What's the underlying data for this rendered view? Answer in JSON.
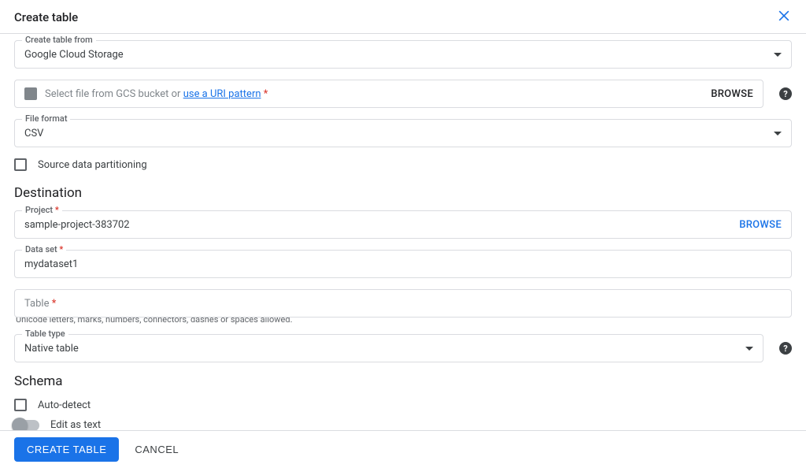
{
  "header": {
    "title": "Create table"
  },
  "source": {
    "create_from_label": "Create table from",
    "create_from_value": "Google Cloud Storage",
    "file_prompt_prefix": "Select file from GCS bucket or ",
    "file_prompt_link": "use a URI pattern",
    "browse_label": "BROWSE",
    "file_format_label": "File format",
    "file_format_value": "CSV",
    "partitioning_label": "Source data partitioning"
  },
  "destination": {
    "title": "Destination",
    "project_label": "Project",
    "project_value": "sample-project-383702",
    "browse_label": "BROWSE",
    "dataset_label": "Data set",
    "dataset_value": "mydataset1",
    "table_label": "Table",
    "table_value": "",
    "table_hint": "Unicode letters, marks, numbers, connectors, dashes or spaces allowed.",
    "table_type_label": "Table type",
    "table_type_value": "Native table"
  },
  "schema": {
    "title": "Schema",
    "autodetect_label": "Auto-detect",
    "edit_as_text_label": "Edit as text"
  },
  "footer": {
    "create_label": "CREATE TABLE",
    "cancel_label": "CANCEL"
  },
  "required_marker": "*"
}
